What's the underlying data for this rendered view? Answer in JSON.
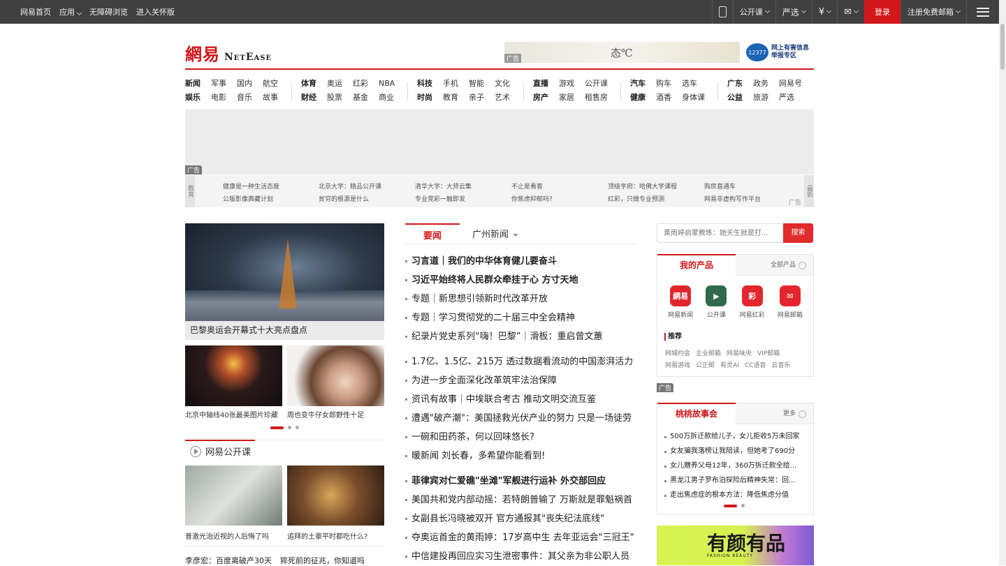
{
  "topbar": {
    "left": [
      "网易首页",
      "应用",
      "无障碍浏览",
      "进入关怀版"
    ],
    "right": [
      "公开课",
      "严选",
      "¥",
      "✉",
      "登录",
      "注册免费邮箱"
    ]
  },
  "header": {
    "logo_cn": "網易",
    "logo_en": "NetEase",
    "ad_label": "广告",
    "ad_text": "态℃",
    "report_badge": "12377",
    "report_line1": "网上有害信息",
    "report_line2": "举报专区"
  },
  "nav": {
    "groups": [
      [
        "新闻",
        "娱乐",
        "军事",
        "电影",
        "国内",
        "音乐",
        "航空",
        "故事"
      ],
      [
        "体育",
        "财经",
        "奥运",
        "股票",
        "红彩",
        "基金",
        "NBA",
        "商业"
      ],
      [
        "科技",
        "时尚",
        "手机",
        "教育",
        "智能",
        "亲子",
        "文化",
        "艺术"
      ],
      [
        "直播",
        "房产",
        "游戏",
        "家居",
        "公开课",
        "租售房"
      ],
      [
        "汽车",
        "健康",
        "购车",
        "酒香",
        "选车",
        "身体课"
      ],
      [
        "广东",
        "公益",
        "政务",
        "旅游",
        "网易号",
        "严选"
      ]
    ]
  },
  "big_ad": {
    "label": "广告"
  },
  "ribbon": {
    "left_label": "教育",
    "right_label": "最新",
    "ad": "广告",
    "cols": [
      [
        "健康是一种生活态度",
        "公版影像典藏计划"
      ],
      [
        "北京大学：精品公开课",
        "贫穷的根源是什么"
      ],
      [
        "清华大学：大师云集",
        "专业竞彩一触即发"
      ],
      [
        "不止是看客",
        "你焦虑抑郁吗?"
      ],
      [
        "顶级学府：哈佛大学课程",
        "红彩，只做专业预测"
      ],
      [
        "购房直通车",
        "网易非虚构写作平台"
      ]
    ]
  },
  "left": {
    "hero_caption": "巴黎奥运会开幕式十大亮点盘点",
    "thumb1": "北京中轴线40张最美图片珍藏",
    "thumb2": "周也变牛仔女郎野性十足",
    "open_course_title": "网易公开课",
    "oc1": "普激光治近视的人后悔了吗",
    "oc2": "追拜的土豪平时都吃什么?",
    "bottom": [
      "李彦宏：百度离破产30天",
      "猝死前的征兆，你知道吗"
    ]
  },
  "middle": {
    "tab_active": "要闻",
    "tab_other": "广州新闻",
    "group1": [
      {
        "text": "习言道｜我们的中华体育健儿要奋斗",
        "bold": true
      },
      {
        "text": "习近平始终将人民群众牵挂于心 方寸天地",
        "bold": true
      },
      {
        "text": "专题｜新思想引领新时代改革开放",
        "bold": false
      },
      {
        "text": "专题｜学习贯彻党的二十届三中全会精神",
        "bold": false
      },
      {
        "text": "纪录片党史系列“嗨！巴黎”｜滑板：重启曾文蕙",
        "bold": false
      }
    ],
    "group2": [
      {
        "text": "1.7亿、1.5亿、215万 透过数据看流动的中国澎湃活力",
        "bold": false
      },
      {
        "text": "为进一步全面深化改革筑牢法治保障",
        "bold": false
      },
      {
        "text": "资讯有故事｜中埃联合考古 推动文明交流互鉴",
        "bold": false
      },
      {
        "text": "遭遇\"破产潮\"：美国拯救光伏产业的努力 只是一场徒劳",
        "bold": false
      },
      {
        "text": "一碗和田药茶，何以回味悠长?",
        "bold": false
      },
      {
        "text": "暖新闻 刘长春，多希望你能看到!",
        "bold": false
      }
    ],
    "group3": [
      {
        "text": "菲律宾对仁爱礁\"坐滩\"军舰进行运补 外交部回应",
        "bold": true
      },
      {
        "text": "美国共和党内部动摇：若特朗普输了 万斯就是罪魁祸首",
        "bold": false
      },
      {
        "text": "女副县长冯晓被双开 官方通报其\"丧失纪法底线\"",
        "bold": false
      },
      {
        "text": "夺奥运首金的黄雨婷：17岁高中生 去年亚运会\"三冠王\"",
        "bold": false
      },
      {
        "text": "中信建投再回应实习生泄密事件：其父亲为非公职人员",
        "bold": false
      }
    ]
  },
  "right": {
    "search_placeholder": "黄雨婷启蒙教练：她天生就是打...",
    "search_button": "搜索",
    "products_title": "我的产品",
    "products_more": "全部产品",
    "products": [
      {
        "label": "网易新闻",
        "glyph": "網易",
        "color": "#e0262b"
      },
      {
        "label": "公开课",
        "glyph": "▶",
        "color": "#2f6b4a"
      },
      {
        "label": "网易红彩",
        "glyph": "彩",
        "color": "#e3262d"
      },
      {
        "label": "网易邮箱",
        "glyph": "✉",
        "color": "#e3262d"
      }
    ],
    "recommend": "推荐",
    "rec_row1": [
      "网城约会",
      "企业邮箱",
      "网易味央",
      "VIP邮箱"
    ],
    "rec_row2": [
      "网易游戏",
      "公正邮",
      "有灵AI",
      "CC语音",
      "云音乐"
    ],
    "ad_label": "广告",
    "story_title": "桃桃故事会",
    "story_more": "更多",
    "stories": [
      "500万拆迁款给儿子，女儿拒收5万未回家",
      "女友骗我落榜让我陪读，但她考了690分",
      "女儿赡养父母12年，360万拆迁款全给...",
      "黑龙江男子罗布泊探险后精神失常：回...",
      "走出焦虑症的根本方法：降低焦虑分值"
    ],
    "fashion_title": "有颜有品",
    "fashion_sub": "FASHION BEAUTY"
  }
}
